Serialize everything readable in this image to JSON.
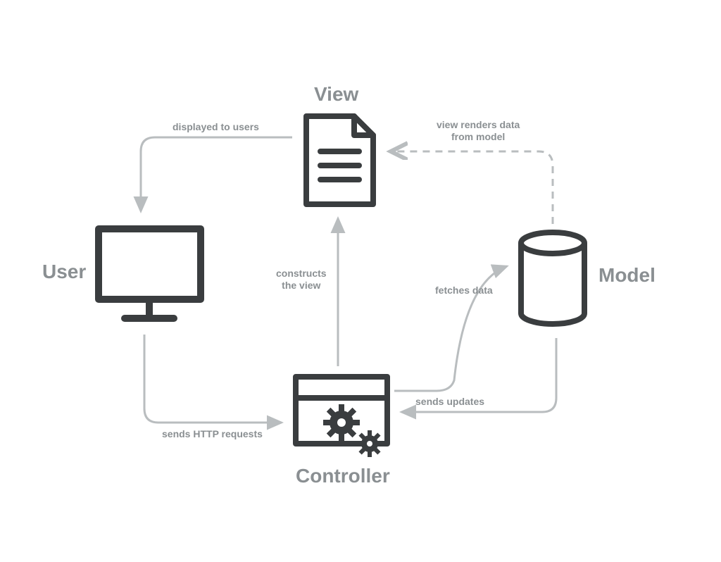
{
  "nodes": {
    "view": {
      "title": "View"
    },
    "user": {
      "title": "User"
    },
    "model": {
      "title": "Model"
    },
    "controller": {
      "title": "Controller"
    }
  },
  "edges": {
    "view_to_user": "displayed to users",
    "model_to_view": "view renders data\nfrom model",
    "controller_to_view": "constructs\nthe view",
    "controller_to_model": "fetches data",
    "model_to_controller": "sends updates",
    "user_to_controller": "sends HTTP requests"
  },
  "colors": {
    "icon_stroke": "#3a3d3f",
    "arrow": "#b9bdbf",
    "label": "#8a8f92"
  }
}
